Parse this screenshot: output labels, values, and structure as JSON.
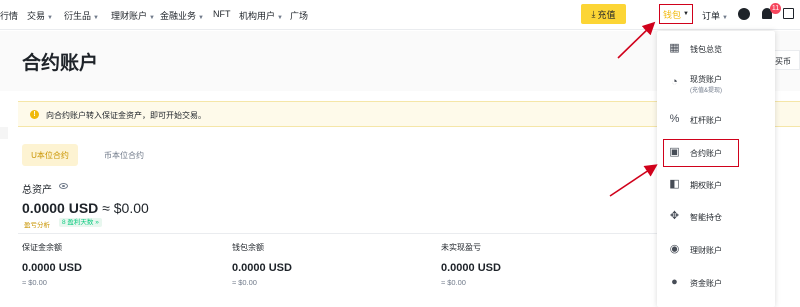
{
  "nav": {
    "items": [
      {
        "label": "行情",
        "dropdown": false
      },
      {
        "label": "交易",
        "dropdown": true
      },
      {
        "label": "衍生品",
        "dropdown": true
      },
      {
        "label": "理财账户",
        "dropdown": true
      },
      {
        "label": "金融业务",
        "dropdown": true
      },
      {
        "label": "NFT",
        "dropdown": false
      },
      {
        "label": "机构用户",
        "dropdown": true
      },
      {
        "label": "广场",
        "dropdown": false
      }
    ],
    "recharge_label": "充值",
    "wallet_label": "钱包",
    "orders_label": "订单",
    "notification_count": "11",
    "accent_color": "#fcd535"
  },
  "page": {
    "title": "合约账户",
    "header_button_partial": "买币"
  },
  "notice": {
    "text": "向合约账户转入保证金资产，即可开始交易。"
  },
  "tabs": [
    {
      "label": "U本位合约",
      "active": true
    },
    {
      "label": "币本位合约",
      "active": false
    }
  ],
  "assets": {
    "total_label": "总资产",
    "total_value": "0.0000 USD",
    "total_approx": " ≈ $0.00",
    "pnl_analysis": "盈亏分析",
    "pnl_badge": "8 盈利天数 »",
    "metrics": [
      {
        "label": "保证金余额",
        "value": "0.0000 USD",
        "sub": "≈ $0.00"
      },
      {
        "label": "钱包余额",
        "value": "0.0000 USD",
        "sub": "≈ $0.00"
      },
      {
        "label": "未实现盈亏",
        "value": "0.0000 USD",
        "sub": "≈ $0.00"
      }
    ]
  },
  "wallet_menu": {
    "items": [
      {
        "label": "钱包总览",
        "sub": "",
        "icon": "grid-icon"
      },
      {
        "label": "现货账户",
        "sub": "(充值&提现)",
        "icon": "spot-icon"
      },
      {
        "label": "杠杆账户",
        "sub": "",
        "icon": "percent-icon"
      },
      {
        "label": "合约账户",
        "sub": "",
        "icon": "futures-icon"
      },
      {
        "label": "期权账户",
        "sub": "",
        "icon": "options-icon"
      },
      {
        "label": "智能持仓",
        "sub": "",
        "icon": "smart-icon"
      },
      {
        "label": "理财账户",
        "sub": "",
        "icon": "earn-icon"
      },
      {
        "label": "资金账户",
        "sub": "",
        "icon": "funding-icon"
      }
    ],
    "highlight_color": "#d0011b"
  }
}
